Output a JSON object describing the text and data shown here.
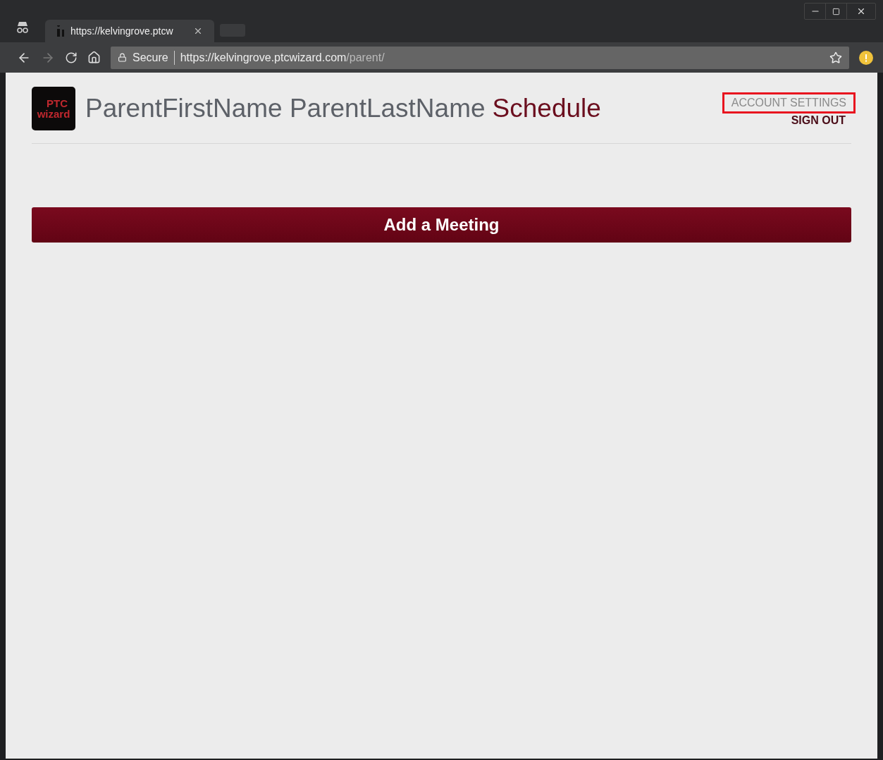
{
  "browser": {
    "tab_title": "https://kelvingrove.ptcw",
    "secure_label": "Secure",
    "url_host": "https://kelvingrove.ptcwizard.com",
    "url_path": "/parent/"
  },
  "header": {
    "logo_top": "PTC",
    "logo_bottom": "wizard",
    "parent_name": "ParentFirstName ParentLastName",
    "title": "Schedule"
  },
  "links": [
    {
      "label": "ACCOUNT SETTINGS",
      "highlighted": true
    },
    {
      "label": "SIGN OUT",
      "highlighted": false
    }
  ],
  "add_button": "Add a Meeting"
}
